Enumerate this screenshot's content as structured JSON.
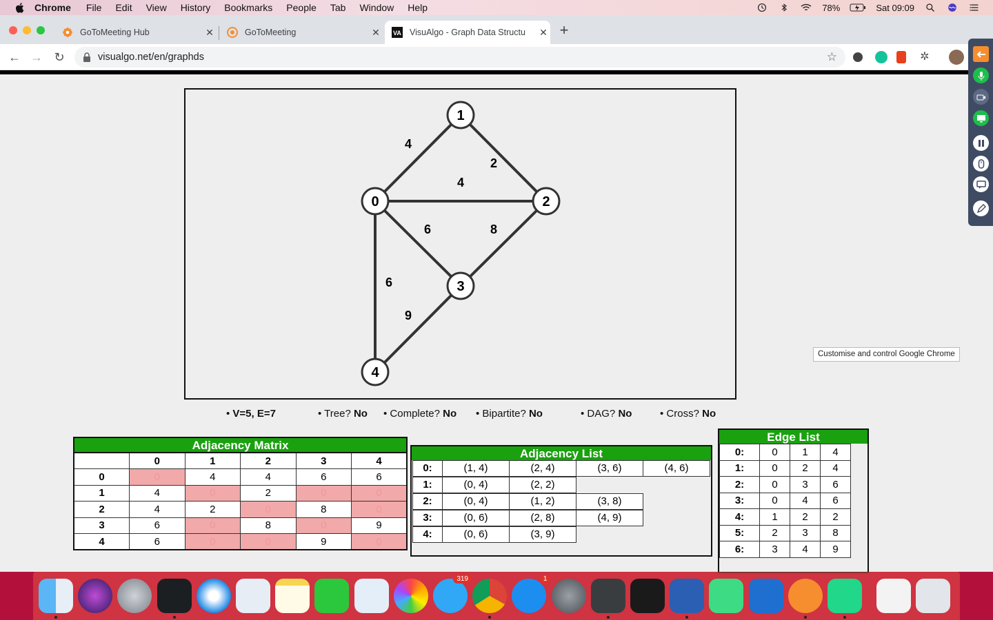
{
  "menubar": {
    "app": "Chrome",
    "items": [
      "File",
      "Edit",
      "View",
      "History",
      "Bookmarks",
      "People",
      "Tab",
      "Window",
      "Help"
    ],
    "battery": "78%",
    "clock": "Sat 09:09"
  },
  "tabs": [
    {
      "title": "GoToMeeting Hub",
      "active": false
    },
    {
      "title": "GoToMeeting",
      "active": false
    },
    {
      "title": "VisuAlgo - Graph Data Structu",
      "active": true
    }
  ],
  "address": {
    "url": "visualgo.net/en/graphds"
  },
  "graph": {
    "vertices": [
      {
        "id": "1",
        "label": "1"
      },
      {
        "id": "0",
        "label": "0"
      },
      {
        "id": "2",
        "label": "2"
      },
      {
        "id": "3",
        "label": "3"
      },
      {
        "id": "4",
        "label": "4"
      }
    ],
    "edges": [
      {
        "from": "0",
        "to": "1",
        "weight": "4"
      },
      {
        "from": "1",
        "to": "2",
        "weight": "2"
      },
      {
        "from": "0",
        "to": "2",
        "weight": "4"
      },
      {
        "from": "0",
        "to": "3",
        "weight": "6"
      },
      {
        "from": "2",
        "to": "3",
        "weight": "8"
      },
      {
        "from": "0",
        "to": "4",
        "weight": "6"
      },
      {
        "from": "3",
        "to": "4",
        "weight": "9"
      }
    ]
  },
  "properties": {
    "ve": "V=5, E=7",
    "tree_label": "Tree? ",
    "tree": "No",
    "complete_label": "Complete? ",
    "complete": "No",
    "bipartite_label": "Bipartite? ",
    "bipartite": "No",
    "dag_label": "DAG? ",
    "dag": "No",
    "cross_label": "Cross? ",
    "cross": "No"
  },
  "adjacency_matrix": {
    "title": "Adjacency Matrix",
    "headers": [
      "",
      "0",
      "1",
      "2",
      "3",
      "4"
    ],
    "rows": [
      [
        "0",
        "0",
        "4",
        "4",
        "6",
        "6"
      ],
      [
        "1",
        "4",
        "0",
        "2",
        "0",
        "0"
      ],
      [
        "2",
        "4",
        "2",
        "0",
        "8",
        "0"
      ],
      [
        "3",
        "6",
        "0",
        "8",
        "0",
        "9"
      ],
      [
        "4",
        "6",
        "0",
        "0",
        "9",
        "0"
      ]
    ]
  },
  "adjacency_list": {
    "title": "Adjacency List",
    "rows": [
      {
        "key": "0:",
        "items": [
          "(1, 4)",
          "(2, 4)",
          "(3, 6)",
          "(4, 6)"
        ]
      },
      {
        "key": "1:",
        "items": [
          "(0, 4)",
          "(2, 2)"
        ]
      },
      {
        "key": "2:",
        "items": [
          "(0, 4)",
          "(1, 2)",
          "(3, 8)"
        ]
      },
      {
        "key": "3:",
        "items": [
          "(0, 6)",
          "(2, 8)",
          "(4, 9)"
        ]
      },
      {
        "key": "4:",
        "items": [
          "(0, 6)",
          "(3, 9)"
        ]
      }
    ]
  },
  "edge_list": {
    "title": "Edge List",
    "rows": [
      [
        "0:",
        "0",
        "1",
        "4"
      ],
      [
        "1:",
        "0",
        "2",
        "4"
      ],
      [
        "2:",
        "0",
        "3",
        "6"
      ],
      [
        "3:",
        "0",
        "4",
        "6"
      ],
      [
        "4:",
        "1",
        "2",
        "2"
      ],
      [
        "5:",
        "2",
        "3",
        "8"
      ],
      [
        "6:",
        "3",
        "4",
        "9"
      ]
    ]
  },
  "tooltip": "Customise and control Google Chrome",
  "dock": {
    "apps": [
      "finder-icon",
      "siri-icon",
      "launchpad-icon",
      "activity-monitor-icon",
      "safari-icon",
      "mail-icon",
      "notes-icon",
      "facetime-icon",
      "preview-icon",
      "photos-icon",
      "messages-icon",
      "chrome-icon",
      "app-store-icon",
      "system-preferences-icon",
      "sublime-text-icon",
      "terminal-icon",
      "word-icon",
      "android-studio-icon",
      "xcode-icon",
      "gotomeeting-icon",
      "pycharm-icon",
      "pdf-document-icon",
      "trash-icon"
    ],
    "messages_badge": "319",
    "appstore_badge": "1"
  }
}
